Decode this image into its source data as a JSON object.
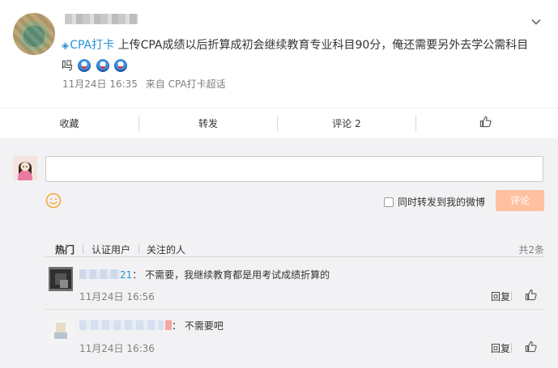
{
  "post": {
    "topic_label": "CPA打卡",
    "text": "上传CPA成绩以后折算成初会继续教育专业科目90分，俺还需要另外去学公需科目吗",
    "emoji_icons": [
      "doraemon-emoji",
      "doraemon-emoji",
      "doraemon-emoji"
    ],
    "date": "11月24日 16:35",
    "source": "来自 CPA打卡超话"
  },
  "actions": {
    "collect": "收藏",
    "forward": "转发",
    "comment": "评论 2",
    "like_icon": "thumb-up-icon"
  },
  "compose": {
    "forward_checkbox_label": "同时转发到我的微博",
    "submit": "评论",
    "submit_color": "#ffc09f",
    "emoji_icon": "smiley-icon"
  },
  "comment_tabs": {
    "tabs": [
      "热门",
      "认证用户",
      "关注的人"
    ],
    "total": "共2条"
  },
  "comments": [
    {
      "name_suffix": "21",
      "text": "：  不需要，我继续教育都是用考试成绩折算的",
      "time": "11月24日 16:56",
      "reply": "回复"
    },
    {
      "name_suffix": "",
      "text": "：  不需要吧",
      "time": "11月24日 16:36",
      "reply": "回复"
    }
  ],
  "colors": {
    "accent": "#eb7350",
    "topic_blue": "#2a8fd6",
    "panel_bg": "#f2f2f5"
  }
}
